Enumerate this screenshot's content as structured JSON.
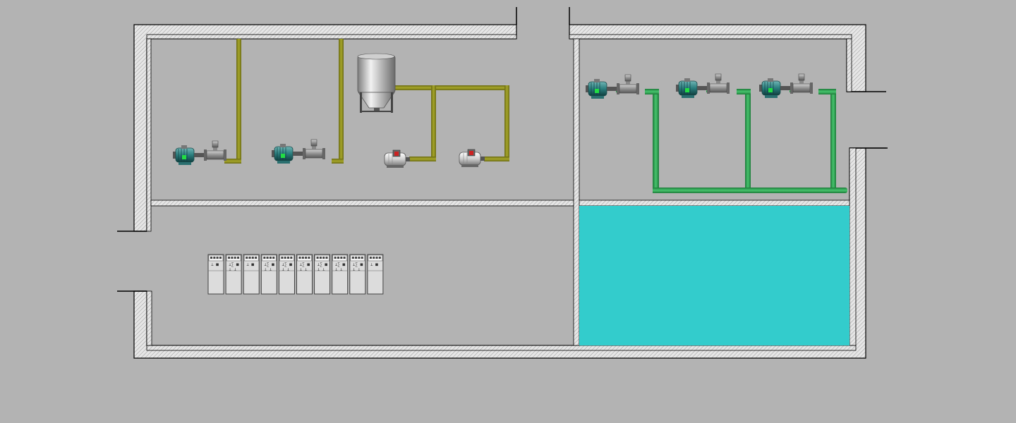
{
  "colors": {
    "background": "#b3b3b3",
    "wall_line": "#000000",
    "wall_fill": "#e3e3e3",
    "oil_pipe": "#8a8a1c",
    "oil_pipe_dark": "#5c5c10",
    "water_pipe": "#2eaa55",
    "water_pipe_dark": "#1d7a3a",
    "water_tank": "#33cccc",
    "motor_teal": "#2a8f8f",
    "motor_light": "#e8e8e8",
    "motor_red": "#cc2222",
    "cabinet": "#dcdcdc"
  },
  "rooms": [
    "upper-left-room",
    "upper-right-room",
    "lower-left-room",
    "water-tank-room"
  ],
  "equipment": {
    "hopper": {
      "icon": "hopper-tank-icon"
    },
    "oil_pumps": [
      {
        "name": "oil-pump-1",
        "icon": "teal-motor-icon"
      },
      {
        "name": "oil-pump-2",
        "icon": "teal-motor-icon"
      }
    ],
    "motors": [
      {
        "name": "white-motor-1",
        "icon": "white-motor-icon"
      },
      {
        "name": "white-motor-2",
        "icon": "white-motor-icon"
      }
    ],
    "water_pumps": [
      {
        "name": "water-pump-1",
        "icon": "teal-motor-icon"
      },
      {
        "name": "water-pump-2",
        "icon": "teal-motor-icon"
      },
      {
        "name": "water-pump-3",
        "icon": "teal-motor-icon"
      }
    ],
    "cabinets": [
      {
        "label": "⊥ ■",
        "sub": ""
      },
      {
        "label": "⊥∑ ■",
        "sub": "⊥ ⊥"
      },
      {
        "label": "⊥ ■",
        "sub": ""
      },
      {
        "label": "⊥∑ ■",
        "sub": "⊥ ⊥"
      },
      {
        "label": "⊥∑ ■",
        "sub": "⊥ ⊥"
      },
      {
        "label": "⊥∑ ■",
        "sub": "⊥ ⊥"
      },
      {
        "label": "⊥∑ ■",
        "sub": "⊥ ⊥"
      },
      {
        "label": "⊥∑ ■",
        "sub": "⊥ ⊥"
      },
      {
        "label": "⊥∑ ■",
        "sub": "⊥ ⊥"
      },
      {
        "label": "⊥ ■",
        "sub": ""
      }
    ]
  }
}
